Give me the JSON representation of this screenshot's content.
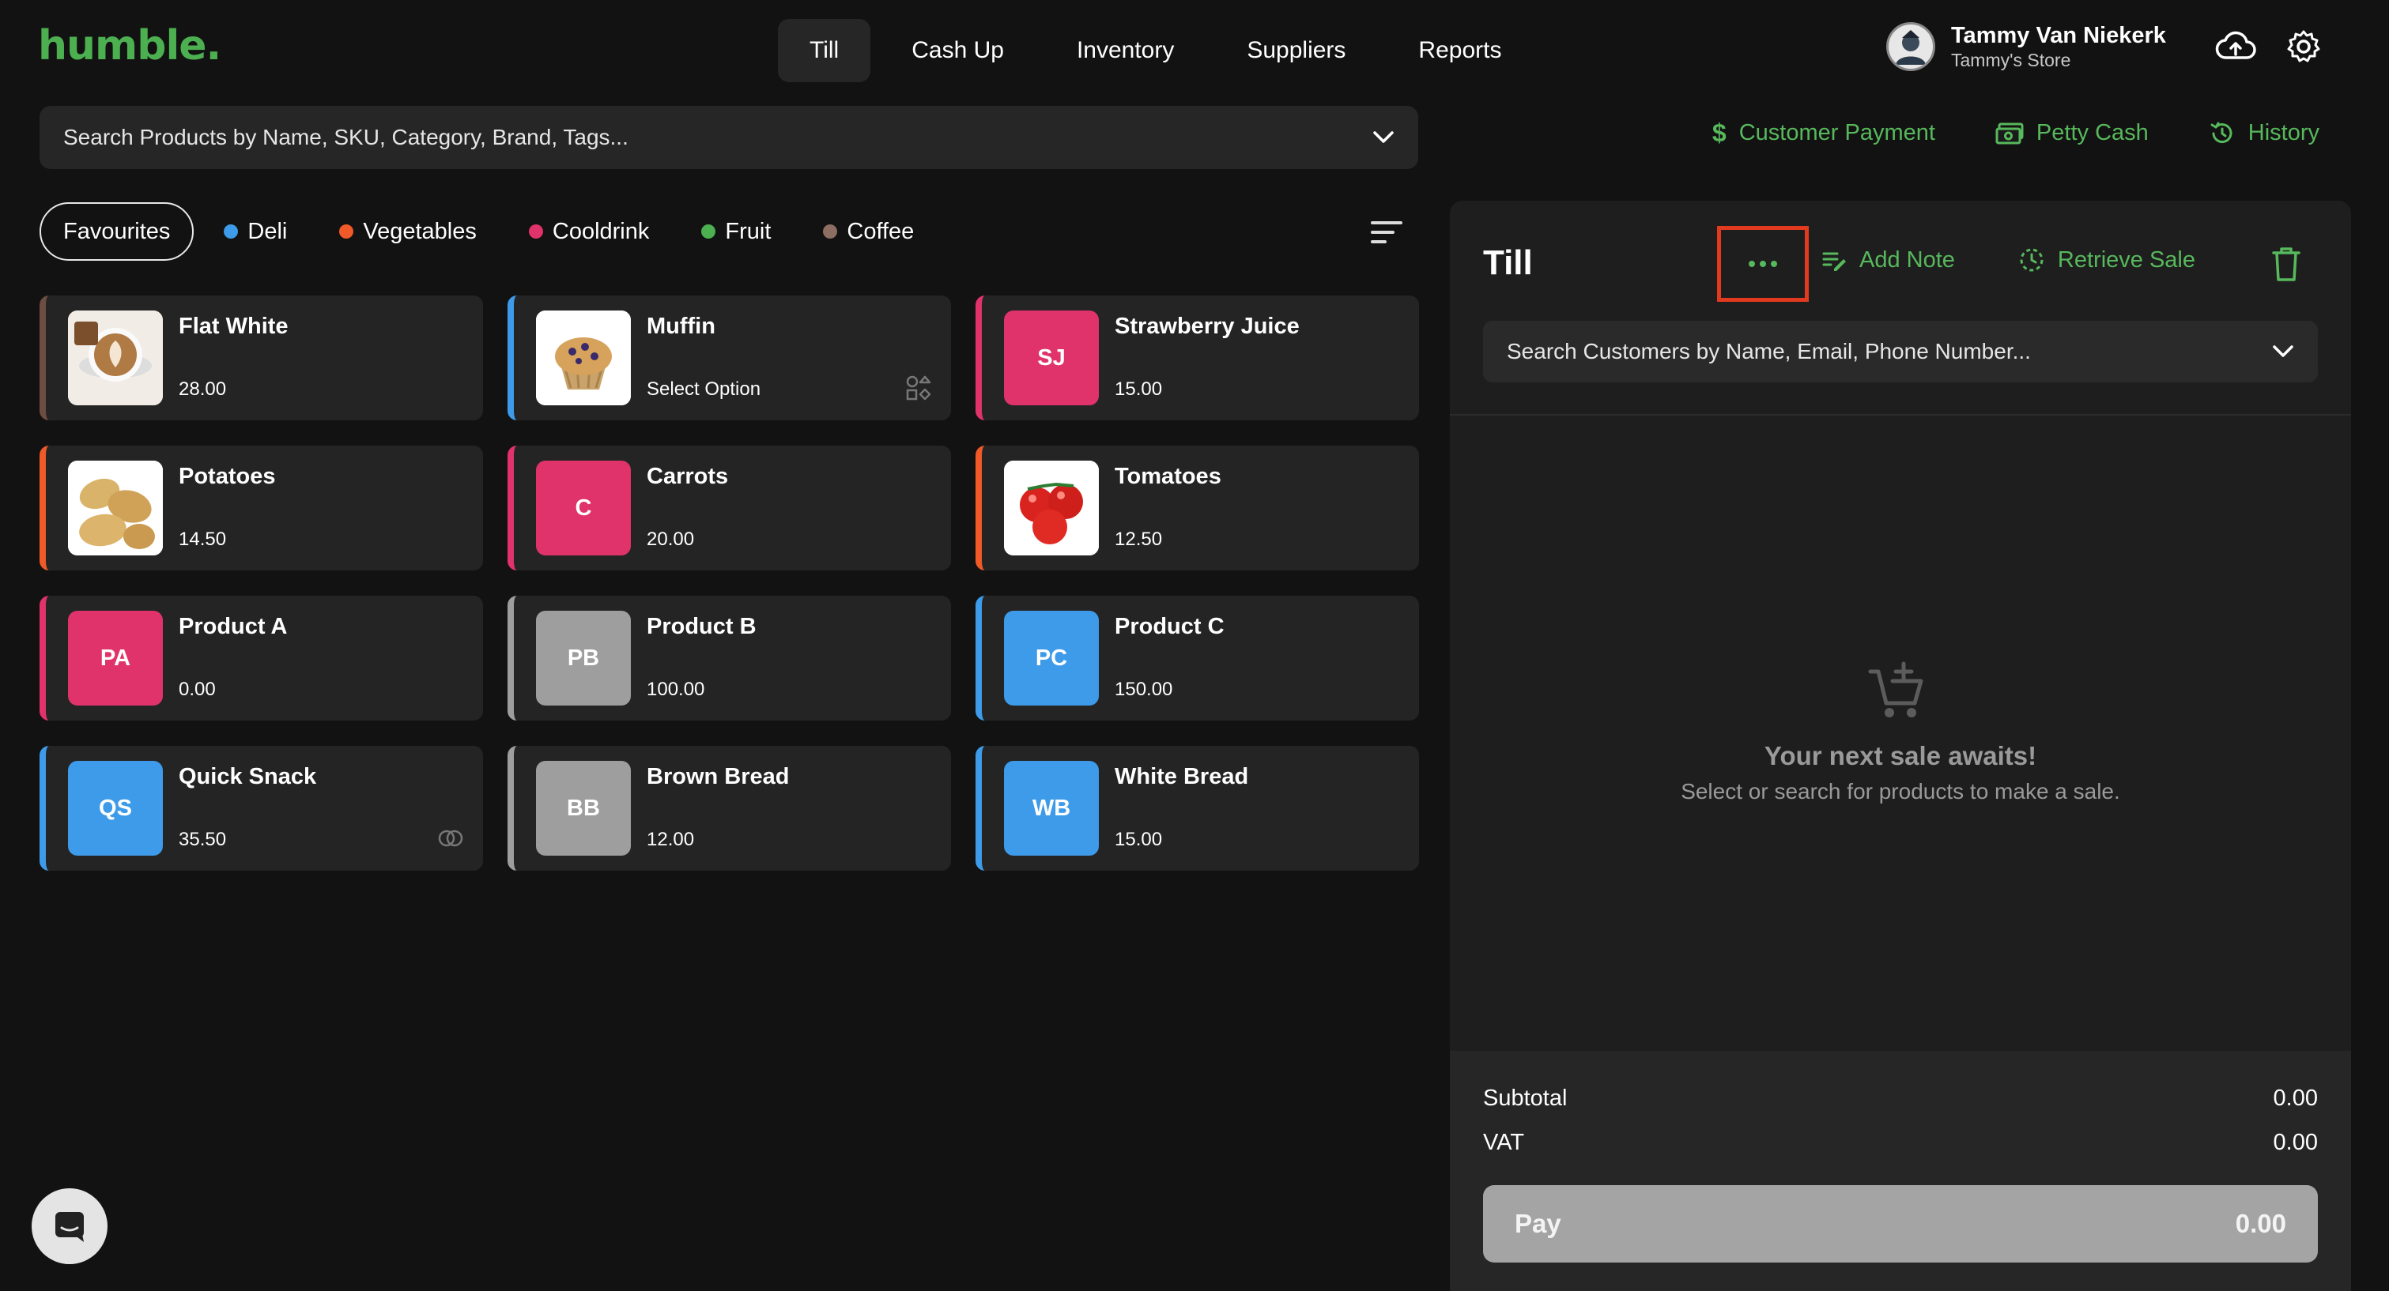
{
  "app": {
    "logo": "humble."
  },
  "nav": {
    "tabs": [
      {
        "label": "Till",
        "active": true
      },
      {
        "label": "Cash Up"
      },
      {
        "label": "Inventory"
      },
      {
        "label": "Suppliers"
      },
      {
        "label": "Reports"
      }
    ]
  },
  "user": {
    "name": "Tammy Van Niekerk",
    "store": "Tammy's Store"
  },
  "search": {
    "placeholder": "Search Products by Name, SKU, Category, Brand, Tags..."
  },
  "actions": {
    "customer_payment": "Customer Payment",
    "petty_cash": "Petty Cash",
    "history": "History"
  },
  "categories": {
    "favourites": "Favourites",
    "items": [
      {
        "label": "Deli",
        "color": "#3d9be9"
      },
      {
        "label": "Vegetables",
        "color": "#f05a28"
      },
      {
        "label": "Cooldrink",
        "color": "#e0336b"
      },
      {
        "label": "Fruit",
        "color": "#4caf50"
      },
      {
        "label": "Coffee",
        "color": "#8d6e63"
      }
    ]
  },
  "products": [
    {
      "name": "Flat White",
      "price": "28.00",
      "accent": "#6d4c41",
      "thumb": "coffee-image"
    },
    {
      "name": "Muffin",
      "price": "Select Option",
      "accent": "#3d9be9",
      "thumb": "muffin-image",
      "badge": "variants-icon"
    },
    {
      "name": "Strawberry Juice",
      "price": "15.00",
      "accent": "#e0336b",
      "initials": "SJ",
      "tile": "#e0336b"
    },
    {
      "name": "Potatoes",
      "price": "14.50",
      "accent": "#f05a28",
      "thumb": "potatoes-image"
    },
    {
      "name": "Carrots",
      "price": "20.00",
      "accent": "#e0336b",
      "initials": "C",
      "tile": "#e0336b"
    },
    {
      "name": "Tomatoes",
      "price": "12.50",
      "accent": "#f05a28",
      "thumb": "tomatoes-image"
    },
    {
      "name": "Product A",
      "price": "0.00",
      "accent": "#e0336b",
      "initials": "PA",
      "tile": "#e0336b"
    },
    {
      "name": "Product B",
      "price": "100.00",
      "accent": "#9e9e9e",
      "initials": "PB",
      "tile": "#9e9e9e"
    },
    {
      "name": "Product C",
      "price": "150.00",
      "accent": "#3d9be9",
      "initials": "PC",
      "tile": "#3d9be9"
    },
    {
      "name": "Quick Snack",
      "price": "35.50",
      "accent": "#3d9be9",
      "initials": "QS",
      "tile": "#3d9be9",
      "badge": "combo-icon"
    },
    {
      "name": "Brown Bread",
      "price": "12.00",
      "accent": "#9e9e9e",
      "initials": "BB",
      "tile": "#9e9e9e"
    },
    {
      "name": "White Bread",
      "price": "15.00",
      "accent": "#3d9be9",
      "initials": "WB",
      "tile": "#3d9be9"
    }
  ],
  "till": {
    "title": "Till",
    "add_note": "Add Note",
    "retrieve_sale": "Retrieve Sale",
    "customer_search_placeholder": "Search Customers by Name, Email, Phone Number...",
    "empty_title": "Your next sale awaits!",
    "empty_subtitle": "Select or search for products to make a sale.",
    "subtotal_label": "Subtotal",
    "subtotal_value": "0.00",
    "vat_label": "VAT",
    "vat_value": "0.00",
    "pay_label": "Pay",
    "pay_value": "0.00"
  },
  "colors": {
    "accent_green": "#57b85c",
    "highlight_red": "#e23a1e",
    "background": "#121212"
  }
}
